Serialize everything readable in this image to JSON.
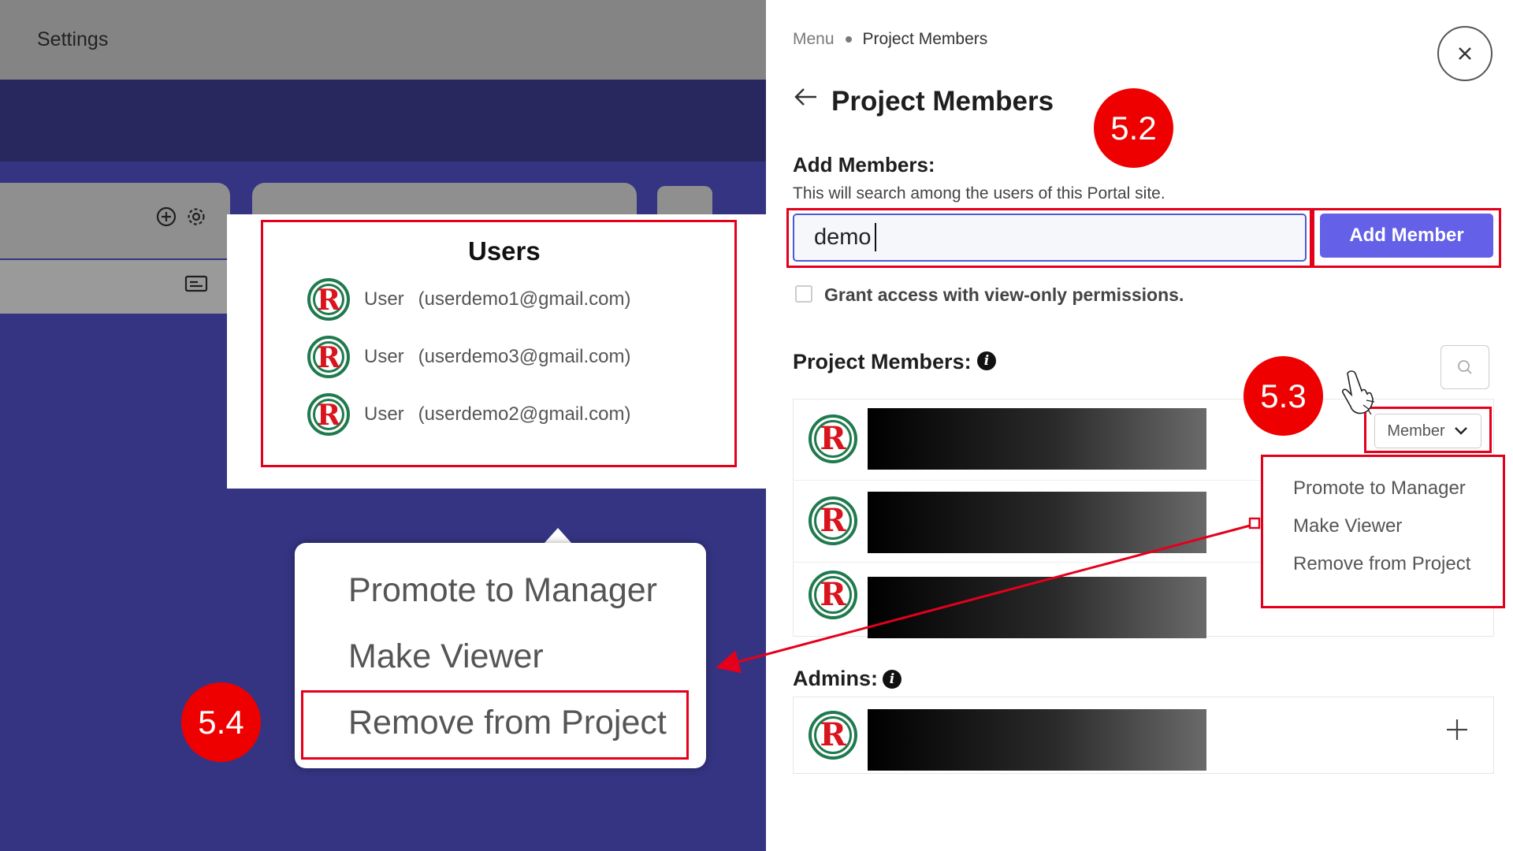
{
  "left_app": {
    "topbar_title": "Settings"
  },
  "users_popover": {
    "title": "Users",
    "users": [
      {
        "name": "User",
        "email": "(userdemo1@gmail.com)"
      },
      {
        "name": "User",
        "email": "(userdemo3@gmail.com)"
      },
      {
        "name": "User",
        "email": "(userdemo2@gmail.com)"
      }
    ]
  },
  "zoom_menu": {
    "items": [
      "Promote to Manager",
      "Make Viewer",
      "Remove from Project"
    ]
  },
  "badges": {
    "step_52": "5.2",
    "step_53": "5.3",
    "step_54": "5.4"
  },
  "panel": {
    "breadcrumb": {
      "root": "Menu",
      "current": "Project Members"
    },
    "title": "Project Members",
    "add_members": {
      "label": "Add Members:",
      "help": "This will search among the users of this Portal site.",
      "input_value": "demo",
      "button": "Add Member"
    },
    "grant_label": "Grant access with view-only permissions.",
    "grant_checked": false,
    "project_members_label": "Project Members:",
    "member_role_select": "Member",
    "role_menu": [
      "Promote to Manager",
      "Make Viewer",
      "Remove from Project"
    ],
    "admins_label": "Admins:"
  },
  "colors": {
    "accent": "#6460e8",
    "annotation_red": "#e4001b",
    "badge_red": "#ee0000",
    "backdrop": "#343483"
  },
  "icons": [
    "close-icon",
    "back-arrow-icon",
    "info-icon",
    "search-icon",
    "chevron-down-icon",
    "plus-icon",
    "plus-circle-icon",
    "gear-icon",
    "card-icon",
    "hand-cursor-icon"
  ]
}
